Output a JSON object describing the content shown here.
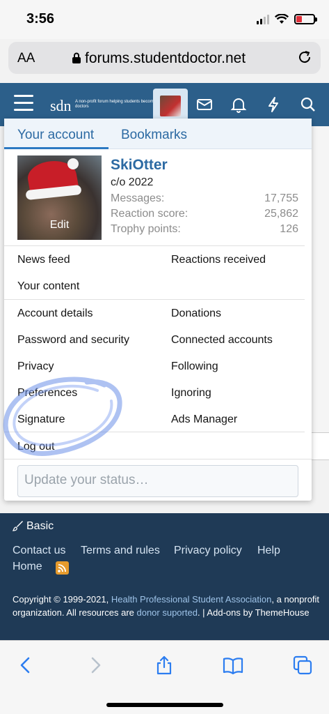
{
  "status_bar": {
    "time": "3:56"
  },
  "browser": {
    "text_size_label": "AA",
    "url": "forums.studentdoctor.net"
  },
  "header": {
    "logo_text": "sdn",
    "logo_tagline": "A non-profit forum helping students become doctors"
  },
  "panel": {
    "tabs": [
      "Your account",
      "Bookmarks"
    ],
    "profile": {
      "edit_label": "Edit",
      "username": "SkiOtter",
      "user_title": "c/o 2022",
      "stats": [
        {
          "label": "Messages:",
          "value": "17,755"
        },
        {
          "label": "Reaction score:",
          "value": "25,862"
        },
        {
          "label": "Trophy points:",
          "value": "126"
        }
      ]
    },
    "menu": {
      "news_feed": "News feed",
      "reactions_received": "Reactions received",
      "your_content": "Your content",
      "account_details": "Account details",
      "donations": "Donations",
      "password_security": "Password and security",
      "connected_accounts": "Connected accounts",
      "privacy": "Privacy",
      "following": "Following",
      "preferences": "Preferences",
      "ignoring": "Ignoring",
      "signature": "Signature",
      "ads_manager": "Ads Manager",
      "log_out": "Log out"
    },
    "status_placeholder": "Update your status…"
  },
  "footer": {
    "style_label": "Basic",
    "links": [
      "Contact us",
      "Terms and rules",
      "Privacy policy",
      "Help",
      "Home"
    ],
    "copyright_1": "Copyright © 1999-2021, ",
    "copyright_link": "Health Professional Student Association",
    "copyright_2": ", a nonprofit organization. All resources are ",
    "donor_link": "donor suported",
    "copyright_3": ". | Add-ons by ThemeHouse"
  },
  "colors": {
    "header_bg": "#2c5f8a",
    "accent": "#2c6aa3",
    "footer_bg": "#1f3a56"
  }
}
